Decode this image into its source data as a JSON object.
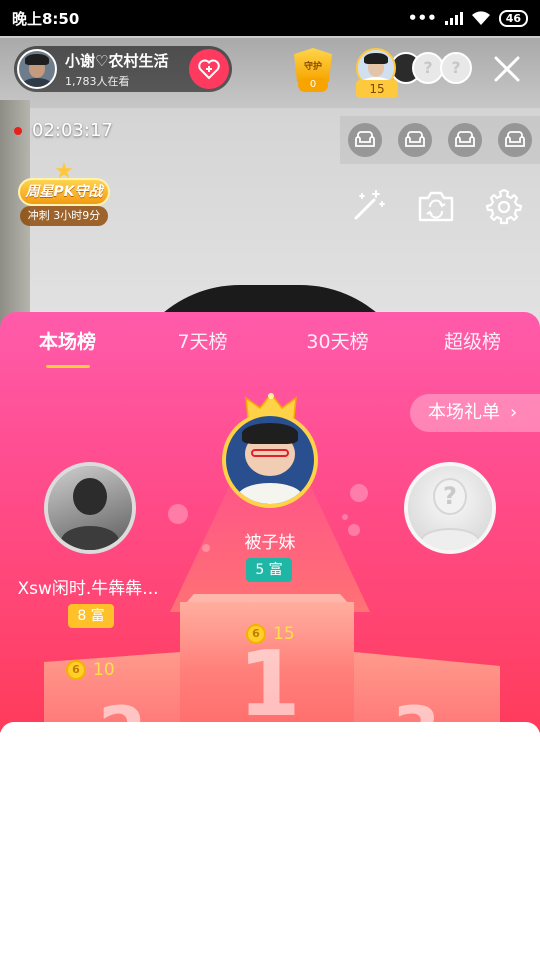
{
  "status_bar": {
    "time": "晚上8:50",
    "battery": "46"
  },
  "host": {
    "name": "小谢♡农村生活",
    "viewers": "1,783人在看"
  },
  "guard": {
    "label": "守护",
    "count": "0"
  },
  "fans": {
    "top_fan_count": "15",
    "placeholder": "?"
  },
  "live": {
    "timer": "02:03:17"
  },
  "weekly_badge": {
    "title": "周星PK守战",
    "subtitle": "冲刺 3小时9分"
  },
  "ranking": {
    "tabs": [
      "本场榜",
      "7天榜",
      "30天榜",
      "超级榜"
    ],
    "active_tab": 0,
    "gift_list_label": "本场礼单",
    "podium_numbers": [
      "1",
      "2",
      "3"
    ],
    "first": {
      "name": "被子妹",
      "rich_level": "5 富",
      "score": "15"
    },
    "second": {
      "name": "Xsw闲时.牛犇犇...",
      "rich_level": "8 富",
      "score": "10"
    },
    "third": {
      "placeholder": "?"
    }
  },
  "colors": {
    "sheet_top": "#ff5bab",
    "sheet_bottom": "#ff3b5a",
    "gold": "#ffd03a",
    "follow": "#ff3a5f"
  }
}
